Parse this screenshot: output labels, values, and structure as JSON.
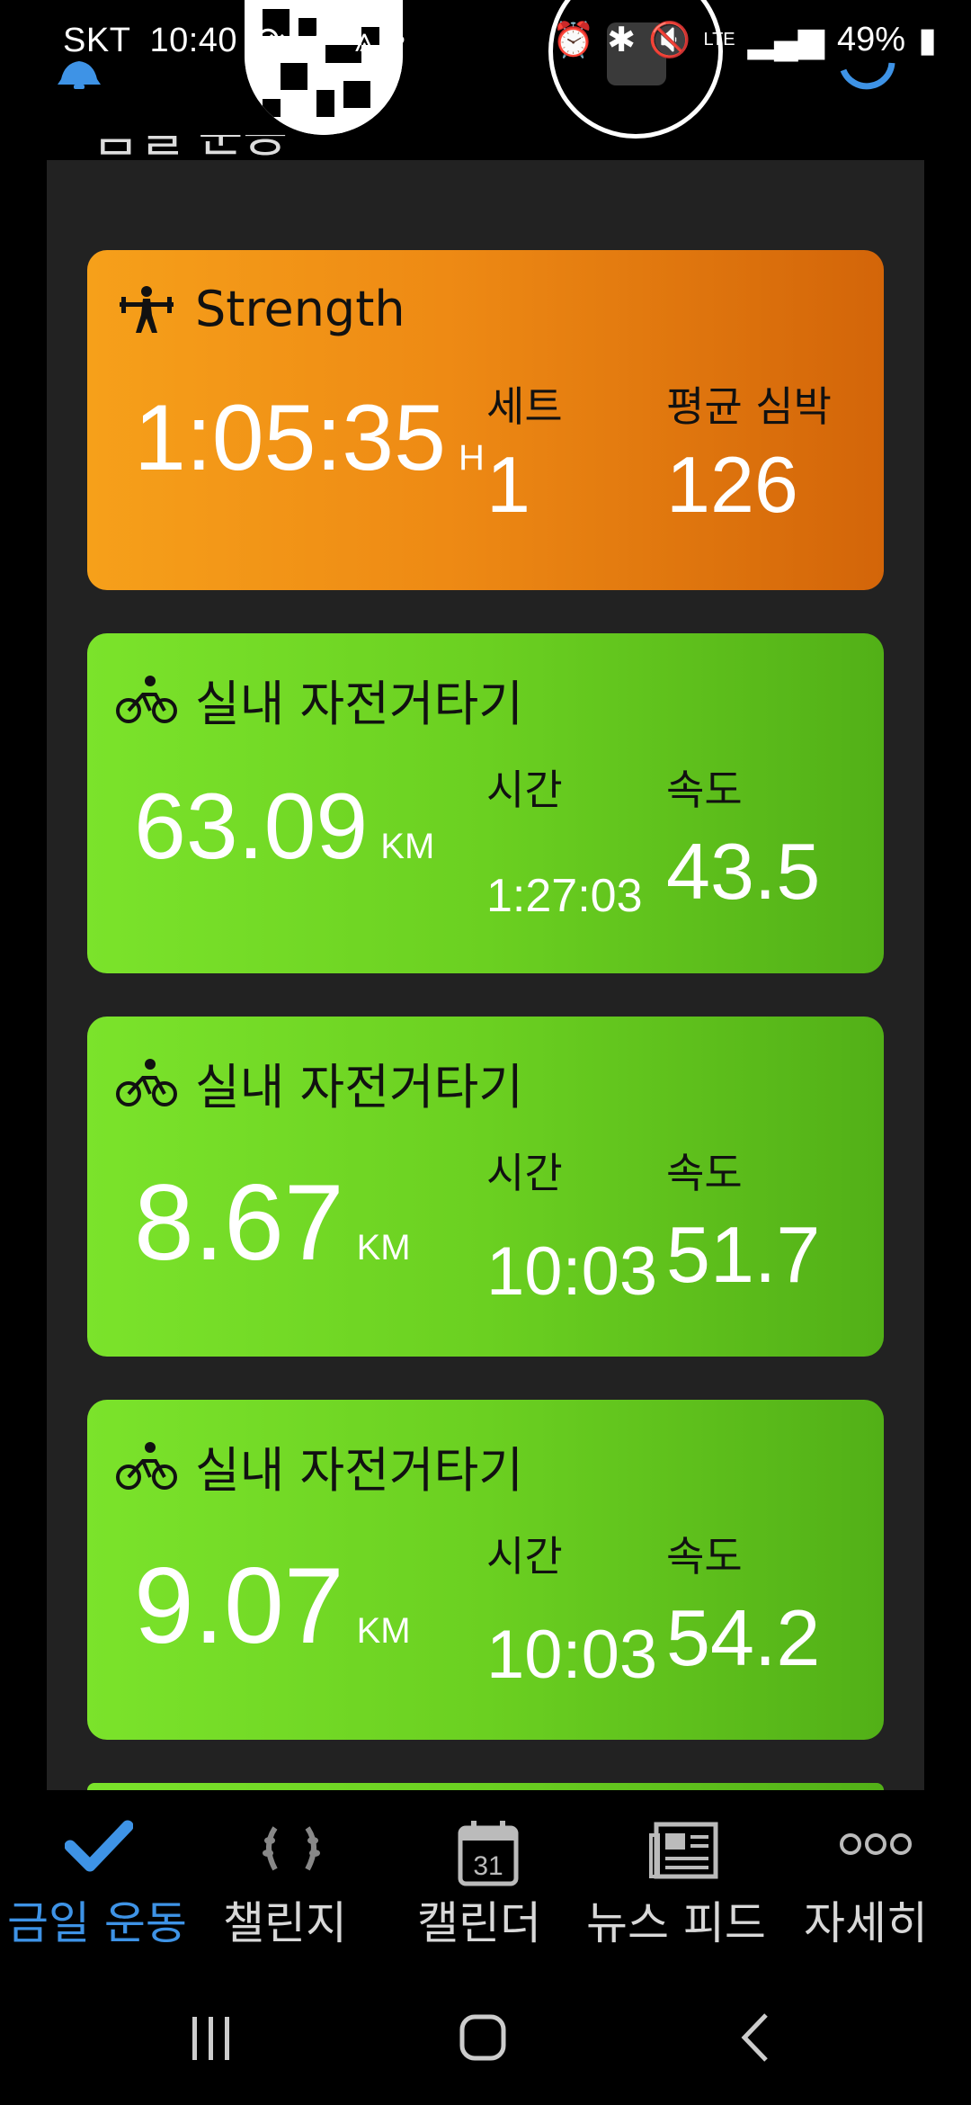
{
  "status": {
    "carrier": "SKT",
    "time": "10:40",
    "temp": "-2°",
    "battery": "49%",
    "lte": "LTE"
  },
  "section": {
    "title": "금일 운동"
  },
  "cards": [
    {
      "type": "Strength",
      "title": "Strength",
      "color": "#ee8a14",
      "big_value": "1:05:35",
      "big_unit": "H",
      "stat1_label": "세트",
      "stat1_value": "1",
      "stat2_label": "평균 심박",
      "stat2_value": "126"
    },
    {
      "type": "cycling",
      "title": "실내 자전거타기",
      "color": "#6bd021",
      "big_value": "63.09",
      "big_unit": "KM",
      "stat1_label": "시간",
      "stat1_value": "1:27:03",
      "stat2_label": "속도",
      "stat2_value": "43.5"
    },
    {
      "type": "cycling",
      "title": "실내 자전거타기",
      "color": "#6bd021",
      "big_value": "8.67",
      "big_unit": "KM",
      "stat1_label": "시간",
      "stat1_value": "10:03",
      "stat2_label": "속도",
      "stat2_value": "51.7"
    },
    {
      "type": "cycling",
      "title": "실내 자전거타기",
      "color": "#6bd021",
      "big_value": "9.07",
      "big_unit": "KM",
      "stat1_label": "시간",
      "stat1_value": "10:03",
      "stat2_label": "속도",
      "stat2_value": "54.2"
    }
  ],
  "nav": {
    "items": [
      {
        "label": "금일 운동",
        "icon": "checkmark-icon",
        "active": true
      },
      {
        "label": "챌린지",
        "icon": "laurel-icon",
        "active": false
      },
      {
        "label": "캘린더",
        "icon": "calendar-icon",
        "calendar_day": "31",
        "active": false
      },
      {
        "label": "뉴스 피드",
        "icon": "newsfeed-icon",
        "active": false
      },
      {
        "label": "자세히",
        "icon": "more-icon",
        "active": false
      }
    ],
    "active_color": "#3e93e6"
  }
}
